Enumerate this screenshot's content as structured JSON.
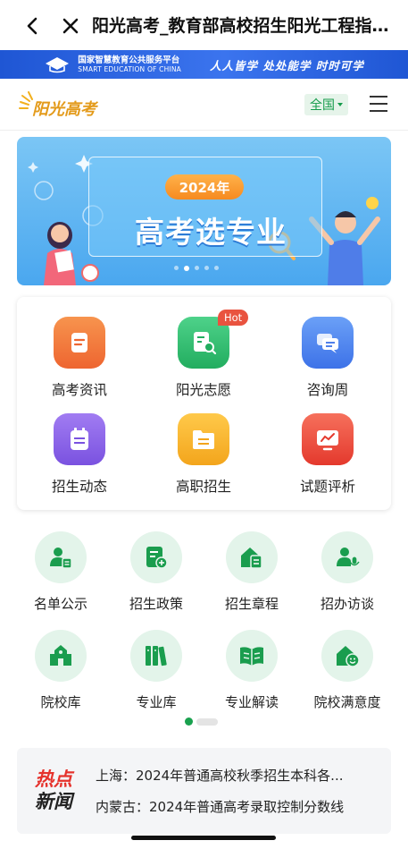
{
  "browser": {
    "title": "阳光高考_教育部高校招生阳光工程指定..."
  },
  "edu_banner": {
    "platform_cn": "国家智慧教育公共服务平台",
    "platform_en": "SMART EDUCATION OF CHINA",
    "slogan": "人人皆学 处处能学 时时可学"
  },
  "header": {
    "brand": "阳光高考",
    "region": "全国"
  },
  "carousel": {
    "year_badge": "2024年",
    "headline": "高考选专业",
    "slide_count": 5,
    "active_slide": 2
  },
  "main_grid": {
    "items": [
      {
        "label": "高考资讯",
        "icon": "document-icon",
        "color": "#f0743a"
      },
      {
        "label": "阳光志愿",
        "icon": "search-list-icon",
        "color": "#2fbf72",
        "badge": "Hot"
      },
      {
        "label": "咨询周",
        "icon": "chat-icon",
        "color": "#4a84f0"
      },
      {
        "label": "招生动态",
        "icon": "calendar-icon",
        "color": "#8b62e8"
      },
      {
        "label": "高职招生",
        "icon": "folder-icon",
        "color": "#f5b329"
      },
      {
        "label": "试题评析",
        "icon": "chart-board-icon",
        "color": "#ef4a3a"
      }
    ]
  },
  "secondary_grid": {
    "items": [
      {
        "label": "名单公示",
        "icon": "user-list-icon"
      },
      {
        "label": "招生政策",
        "icon": "policy-doc-icon"
      },
      {
        "label": "招生章程",
        "icon": "house-doc-icon"
      },
      {
        "label": "招办访谈",
        "icon": "user-mic-icon"
      },
      {
        "label": "院校库",
        "icon": "school-icon"
      },
      {
        "label": "专业库",
        "icon": "books-icon"
      },
      {
        "label": "专业解读",
        "icon": "open-book-icon"
      },
      {
        "label": "院校满意度",
        "icon": "house-smile-icon"
      }
    ],
    "accent": "#1a9d4e"
  },
  "news": {
    "tag_top": "热点",
    "tag_bottom": "新闻",
    "items": [
      "上海：2024年普通高校秋季招生本科各...",
      "内蒙古：2024年普通高考录取控制分数线"
    ]
  }
}
